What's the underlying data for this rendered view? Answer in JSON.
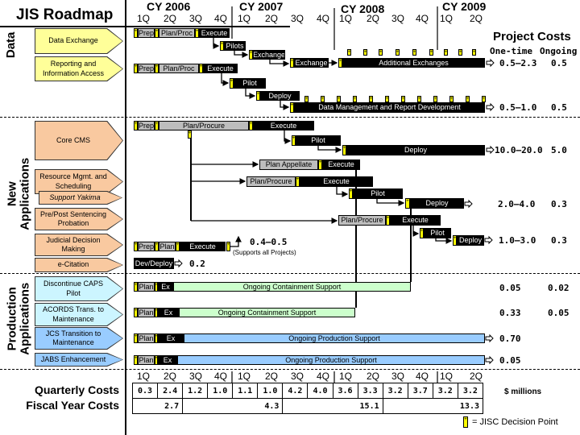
{
  "title": "JIS Roadmap",
  "years": [
    "CY 2006",
    "CY 2007",
    "CY 2008",
    "CY 2009"
  ],
  "quarters": [
    "1Q",
    "2Q",
    "3Q",
    "4Q",
    "1Q",
    "2Q",
    "3Q",
    "4Q",
    "1Q",
    "2Q",
    "3Q",
    "4Q",
    "1Q",
    "2Q"
  ],
  "sections": [
    "Data",
    "New Applications",
    "Production Applications"
  ],
  "project_costs": {
    "title": "Project Costs",
    "one_time_label": "One-time",
    "ongoing_label": "Ongoing"
  },
  "rows": [
    {
      "project": "Data Exchange",
      "bars": [
        "Prep",
        "Plan/Proc",
        "Execute",
        "Pilots",
        "Exchange",
        "Exchange",
        "Additional Exchanges"
      ],
      "one_time": "0.5–2.3",
      "ongoing": "0.5"
    },
    {
      "project": "Reporting and Information Access",
      "bars": [
        "Prep",
        "Plan/Proc",
        "Execute",
        "Pilot",
        "Deploy",
        "Data Management and Report Development"
      ],
      "one_time": "0.5–1.0",
      "ongoing": "0.5"
    },
    {
      "project": "Core CMS",
      "bars": [
        "Prep",
        "Plan/Procure",
        "Execute",
        "Pilot",
        "Deploy"
      ],
      "one_time": "10.0–20.0",
      "ongoing": "5.0"
    },
    {
      "project": "Resource Mgmt. and Scheduling",
      "bars": [
        "Plan Appellate",
        "Execute",
        "Plan/Procure",
        "Execute",
        "Pilot",
        "Deploy"
      ],
      "one_time": "2.0–4.0",
      "ongoing": "0.3"
    },
    {
      "project": "Support Yakima"
    },
    {
      "project": "Pre/Post Sentencing Probation",
      "bars": [
        "Plan/Procure",
        "Execute",
        "Pilot",
        "Deploy"
      ],
      "one_time": "1.0–3.0",
      "ongoing": "0.3"
    },
    {
      "project": "Judicial Decision Making",
      "bars": [
        "Prep",
        "Plan",
        "Execute"
      ],
      "one_time": "0.4–0.5",
      "note": "(Supports all Projects)"
    },
    {
      "project": "e-Citation",
      "bars": [
        "Dev/Deploy"
      ],
      "one_time": "0.2"
    },
    {
      "project": "Discontinue CAPS Pilot",
      "bars": [
        "Plan",
        "Ex",
        "Ongoing Containment Support"
      ],
      "one_time": "0.05",
      "ongoing": "0.02"
    },
    {
      "project": "ACORDS Trans. to Maintenance",
      "bars": [
        "Plan",
        "Ex",
        "Ongoing Containment Support"
      ],
      "one_time": "0.33",
      "ongoing": "0.05"
    },
    {
      "project": "JCS Transition to Maintenance",
      "bars": [
        "Plan",
        "Ex",
        "Ongoing Production Support"
      ],
      "one_time": "0.70"
    },
    {
      "project": "JABS Enhancement",
      "bars": [
        "Plan",
        "Ex",
        "Ongoing Production Support"
      ],
      "one_time": "0.05"
    }
  ],
  "quarterly_costs": {
    "label": "Quarterly Costs",
    "values": [
      "0.3",
      "2.4",
      "1.2",
      "1.0",
      "1.1",
      "1.0",
      "4.2",
      "4.0",
      "3.6",
      "3.3",
      "3.2",
      "3.7",
      "3.2",
      "3.2"
    ]
  },
  "fiscal_year_costs": {
    "label": "Fiscal Year Costs",
    "values": [
      "2.7",
      "4.3",
      "15.1",
      "13.3"
    ]
  },
  "units": "$ millions",
  "legend": {
    "label": "= JISC Decision Point",
    "icon": "decision-point-marker"
  },
  "colors": {
    "data": "#ffff99",
    "new_apps": "#f9c9a0",
    "production_light": "#ccf5ff",
    "production": "#99ccff",
    "decision_point": "#ffff00",
    "containment": "#ccffcc"
  }
}
